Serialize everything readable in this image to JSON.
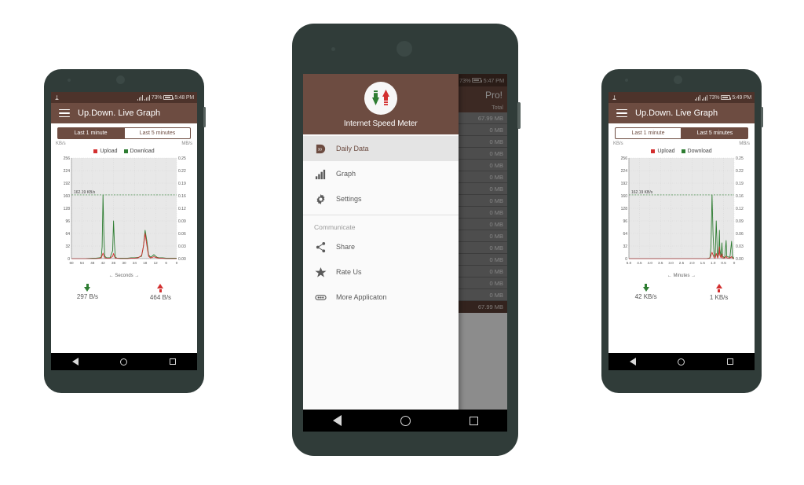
{
  "scene": {
    "background_color": "#ffffff",
    "brand_color": "#6d4c41",
    "upload_color": "#d32f2f",
    "download_color": "#2e7d32"
  },
  "phone_left": {
    "status_bar": {
      "battery": "73%",
      "time": "5:48 PM",
      "icons": [
        "usb-icon",
        "signal-icon",
        "signal-icon",
        "battery-icon"
      ]
    },
    "appbar": {
      "title": "Up.Down. Live Graph",
      "menu_icon": "hamburger-icon"
    },
    "tabs": [
      {
        "label": "Last 1 minute",
        "active": true
      },
      {
        "label": "Last 5 minutes",
        "active": false
      }
    ],
    "units": {
      "left": "KB/s",
      "right": "MB/s"
    },
    "legend": [
      {
        "label": "Upload",
        "color": "#d32f2f"
      },
      {
        "label": "Download",
        "color": "#2e7d32"
      }
    ],
    "peak_label": "162.19 KB/s",
    "speeds": {
      "download": {
        "value": "297 B/s",
        "icon": "download-arrow-icon"
      },
      "upload": {
        "value": "464 B/s",
        "icon": "upload-arrow-icon"
      }
    },
    "nav": {
      "back": "back-icon",
      "home": "home-icon",
      "recents": "recents-icon"
    },
    "chart_data": {
      "type": "line",
      "title": "Up.Down. Live Graph",
      "xlabel": "← Seconds →",
      "ylabel": "KB/s",
      "y2label": "MB/s",
      "xticks": [
        60,
        54,
        48,
        42,
        36,
        30,
        24,
        18,
        12,
        6,
        0
      ],
      "yticks": [
        0,
        32,
        64,
        96,
        128,
        160,
        192,
        224,
        256
      ],
      "y2ticks": [
        "0.00",
        "0.03",
        "0.06",
        "0.09",
        "0.12",
        "0.16",
        "0.19",
        "0.22",
        "0.25"
      ],
      "ylim": [
        0,
        256
      ],
      "xlim": [
        60,
        0
      ],
      "grid": true,
      "legend_position": "top-center",
      "annotation": {
        "text": "162.19 KB/s",
        "y": 162.19,
        "style": "dashed-green-line"
      },
      "series": [
        {
          "name": "Download",
          "color": "#2e7d32",
          "points": [
            [
              60,
              0
            ],
            [
              56,
              0
            ],
            [
              52,
              0
            ],
            [
              48,
              1
            ],
            [
              46,
              1
            ],
            [
              44,
              2
            ],
            [
              43,
              4
            ],
            [
              42.5,
              30
            ],
            [
              42,
              162
            ],
            [
              41.5,
              60
            ],
            [
              41,
              6
            ],
            [
              40,
              2
            ],
            [
              38,
              2
            ],
            [
              36.5,
              20
            ],
            [
              36,
              96
            ],
            [
              35.5,
              40
            ],
            [
              35,
              4
            ],
            [
              34,
              1
            ],
            [
              32,
              1
            ],
            [
              30,
              1
            ],
            [
              28,
              1
            ],
            [
              26,
              2
            ],
            [
              24,
              2
            ],
            [
              22,
              3
            ],
            [
              20,
              6
            ],
            [
              19,
              30
            ],
            [
              18,
              72
            ],
            [
              17,
              45
            ],
            [
              16,
              10
            ],
            [
              15,
              4
            ],
            [
              14,
              6
            ],
            [
              13,
              10
            ],
            [
              12,
              6
            ],
            [
              11,
              3
            ],
            [
              10,
              2
            ],
            [
              8,
              2
            ],
            [
              6,
              1
            ],
            [
              4,
              1
            ],
            [
              2,
              1
            ],
            [
              0,
              1
            ]
          ]
        },
        {
          "name": "Upload",
          "color": "#d32f2f",
          "points": [
            [
              60,
              0
            ],
            [
              56,
              0
            ],
            [
              52,
              0
            ],
            [
              48,
              0
            ],
            [
              46,
              0
            ],
            [
              44,
              1
            ],
            [
              43,
              2
            ],
            [
              42.5,
              8
            ],
            [
              42,
              14
            ],
            [
              41.5,
              8
            ],
            [
              41,
              2
            ],
            [
              40,
              1
            ],
            [
              38,
              1
            ],
            [
              36.5,
              6
            ],
            [
              36,
              13
            ],
            [
              35.5,
              6
            ],
            [
              35,
              1
            ],
            [
              34,
              1
            ],
            [
              32,
              0
            ],
            [
              30,
              0
            ],
            [
              28,
              0
            ],
            [
              26,
              1
            ],
            [
              24,
              1
            ],
            [
              22,
              2
            ],
            [
              20,
              8
            ],
            [
              19,
              30
            ],
            [
              18,
              64
            ],
            [
              17,
              34
            ],
            [
              16,
              6
            ],
            [
              15,
              2
            ],
            [
              14,
              3
            ],
            [
              13,
              5
            ],
            [
              12,
              3
            ],
            [
              11,
              2
            ],
            [
              10,
              1
            ],
            [
              8,
              1
            ],
            [
              6,
              0
            ],
            [
              4,
              0
            ],
            [
              2,
              0
            ],
            [
              0,
              0
            ]
          ]
        }
      ]
    }
  },
  "phone_center": {
    "status_bar": {
      "battery": "73%",
      "time": "5:47 PM",
      "icons": [
        "sim-icon",
        "usb-icon",
        "signal-icon",
        "signal-icon",
        "battery-icon"
      ]
    },
    "background": {
      "appbar_text": "Pro!",
      "table_header": "Total",
      "rows": [
        "67.99 MB",
        "0 MB",
        "0 MB",
        "0 MB",
        "0 MB",
        "0 MB",
        "0 MB",
        "0 MB",
        "0 MB",
        "0 MB",
        "0 MB",
        "0 MB",
        "0 MB",
        "0 MB",
        "0 MB",
        "0 MB"
      ],
      "footer": "67.99 MB"
    },
    "drawer": {
      "app_name": "Internet Speed Meter",
      "app_icon": "speed-meter-icon",
      "items": [
        {
          "label": "Daily Data",
          "icon": "daily-data-icon",
          "selected": true
        },
        {
          "label": "Graph",
          "icon": "bar-chart-icon",
          "selected": false
        },
        {
          "label": "Settings",
          "icon": "gear-icon",
          "selected": false
        }
      ],
      "section_label": "Communicate",
      "communicate_items": [
        {
          "label": "Share",
          "icon": "share-icon"
        },
        {
          "label": "Rate Us",
          "icon": "star-icon"
        },
        {
          "label": "More Applicaton",
          "icon": "more-apps-icon"
        }
      ]
    },
    "nav": {
      "back": "back-icon",
      "home": "home-icon",
      "recents": "recents-icon"
    }
  },
  "phone_right": {
    "status_bar": {
      "battery": "73%",
      "time": "5:49 PM",
      "icons": [
        "usb-icon",
        "signal-icon",
        "signal-icon",
        "battery-icon"
      ]
    },
    "appbar": {
      "title": "Up.Down. Live Graph",
      "menu_icon": "hamburger-icon"
    },
    "tabs": [
      {
        "label": "Last 1 minute",
        "active": false
      },
      {
        "label": "Last 5 minutes",
        "active": true
      }
    ],
    "units": {
      "left": "KB/s",
      "right": "MB/s"
    },
    "legend": [
      {
        "label": "Upload",
        "color": "#d32f2f"
      },
      {
        "label": "Download",
        "color": "#2e7d32"
      }
    ],
    "peak_label": "162.19 KB/s",
    "speeds": {
      "download": {
        "value": "42 KB/s",
        "icon": "download-arrow-icon"
      },
      "upload": {
        "value": "1 KB/s",
        "icon": "upload-arrow-icon"
      }
    },
    "nav": {
      "back": "back-icon",
      "home": "home-icon",
      "recents": "recents-icon"
    },
    "chart_data": {
      "type": "line",
      "title": "Up.Down. Live Graph",
      "xlabel": "← Minutes →",
      "ylabel": "KB/s",
      "y2label": "MB/s",
      "xticks": [
        "5.0",
        "4.5",
        "4.0",
        "3.5",
        "3.0",
        "2.5",
        "2.0",
        "1.5",
        "1.0",
        "0.5",
        "0"
      ],
      "yticks": [
        0,
        32,
        64,
        96,
        128,
        160,
        192,
        224,
        256
      ],
      "y2ticks": [
        "0.00",
        "0.03",
        "0.06",
        "0.09",
        "0.12",
        "0.16",
        "0.19",
        "0.22",
        "0.25"
      ],
      "ylim": [
        0,
        256
      ],
      "xlim": [
        5.0,
        0
      ],
      "grid": true,
      "legend_position": "top-center",
      "annotation": {
        "text": "162.19 KB/s",
        "y": 162.19,
        "style": "dashed-green-line"
      },
      "series": [
        {
          "name": "Download",
          "color": "#2e7d32",
          "points": [
            [
              5.0,
              0
            ],
            [
              4.5,
              0
            ],
            [
              4.0,
              0
            ],
            [
              3.5,
              0
            ],
            [
              3.0,
              0
            ],
            [
              2.5,
              0
            ],
            [
              2.0,
              0
            ],
            [
              1.6,
              0
            ],
            [
              1.5,
              0
            ],
            [
              1.4,
              0
            ],
            [
              1.3,
              0
            ],
            [
              1.15,
              2
            ],
            [
              1.1,
              30
            ],
            [
              1.05,
              162
            ],
            [
              1.0,
              60
            ],
            [
              0.95,
              8
            ],
            [
              0.9,
              4
            ],
            [
              0.85,
              96
            ],
            [
              0.8,
              20
            ],
            [
              0.78,
              4
            ],
            [
              0.72,
              30
            ],
            [
              0.7,
              72
            ],
            [
              0.68,
              24
            ],
            [
              0.62,
              4
            ],
            [
              0.58,
              40
            ],
            [
              0.55,
              6
            ],
            [
              0.45,
              2
            ],
            [
              0.38,
              46
            ],
            [
              0.35,
              6
            ],
            [
              0.2,
              3
            ],
            [
              0.12,
              44
            ],
            [
              0.08,
              6
            ],
            [
              0.04,
              2
            ],
            [
              0,
              2
            ]
          ]
        },
        {
          "name": "Upload",
          "color": "#d32f2f",
          "points": [
            [
              5.0,
              0
            ],
            [
              4.5,
              0
            ],
            [
              4.0,
              0
            ],
            [
              3.5,
              0
            ],
            [
              3.0,
              0
            ],
            [
              2.5,
              0
            ],
            [
              2.0,
              0
            ],
            [
              1.6,
              0
            ],
            [
              1.5,
              0
            ],
            [
              1.4,
              0
            ],
            [
              1.3,
              0
            ],
            [
              1.15,
              1
            ],
            [
              1.1,
              8
            ],
            [
              1.05,
              16
            ],
            [
              1.0,
              9
            ],
            [
              0.95,
              2
            ],
            [
              0.9,
              1
            ],
            [
              0.85,
              13
            ],
            [
              0.8,
              5
            ],
            [
              0.78,
              1
            ],
            [
              0.72,
              14
            ],
            [
              0.7,
              30
            ],
            [
              0.68,
              9
            ],
            [
              0.62,
              2
            ],
            [
              0.58,
              12
            ],
            [
              0.55,
              2
            ],
            [
              0.45,
              1
            ],
            [
              0.38,
              6
            ],
            [
              0.35,
              2
            ],
            [
              0.2,
              1
            ],
            [
              0.12,
              5
            ],
            [
              0.08,
              1
            ],
            [
              0.04,
              0
            ],
            [
              0,
              0
            ]
          ]
        }
      ]
    }
  }
}
